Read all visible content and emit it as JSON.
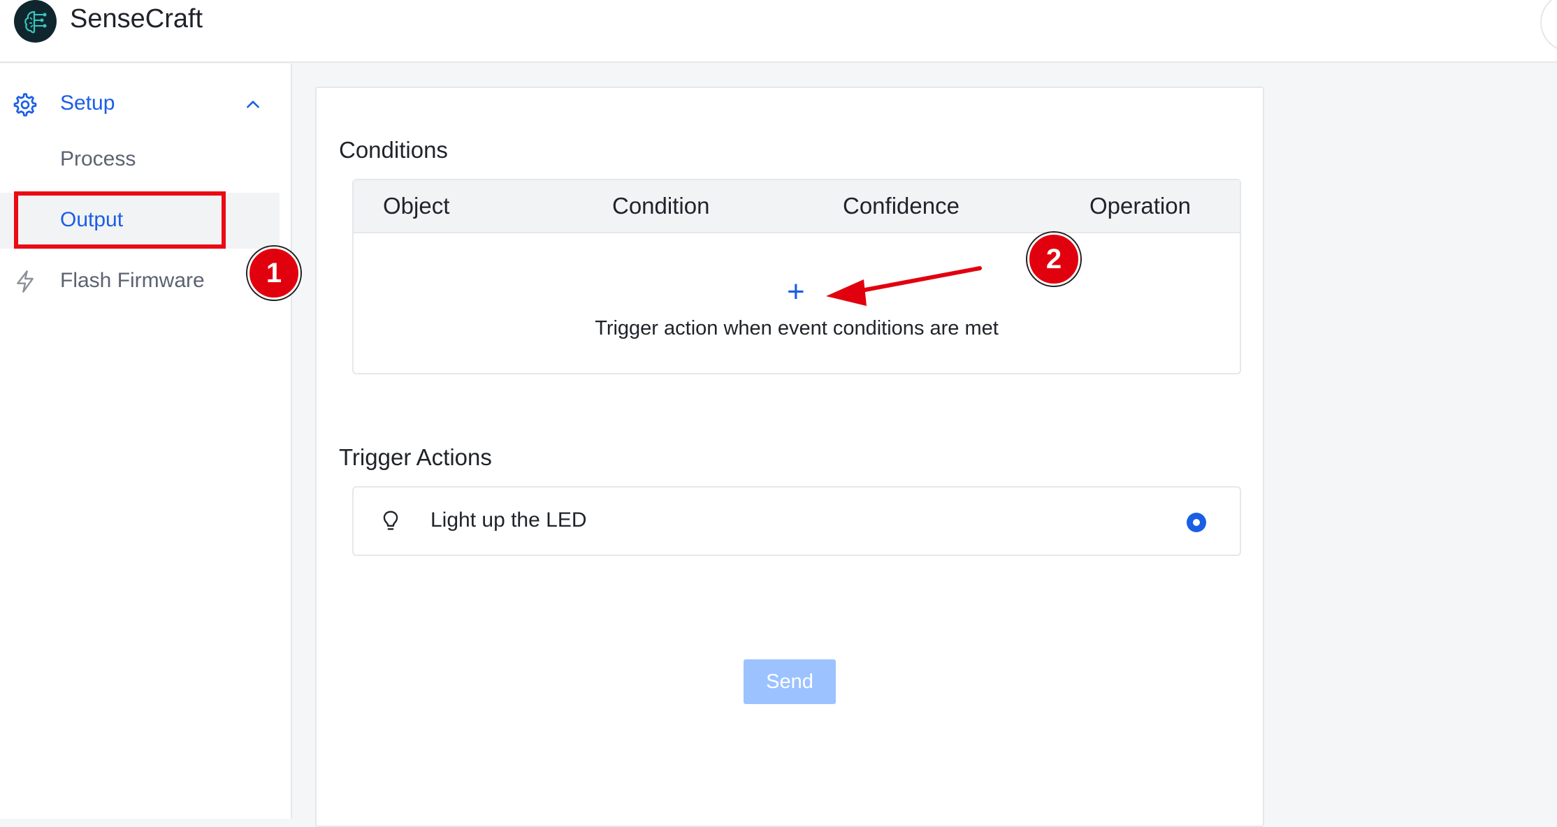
{
  "app": {
    "title": "SenseCraft",
    "logo_icon": "brain-circuit-icon"
  },
  "sidebar": {
    "group": {
      "label": "Setup",
      "icon": "gear-icon",
      "expanded": true
    },
    "items": [
      {
        "label": "Process",
        "active": false
      },
      {
        "label": "Output",
        "active": true
      },
      {
        "label": "Flash Firmware",
        "active": false,
        "icon": "lightning-icon"
      }
    ]
  },
  "annotations": {
    "badge_1": "1",
    "badge_2": "2",
    "highlight_color": "#ea0b14"
  },
  "conditions": {
    "title": "Conditions",
    "columns": [
      "Object",
      "Condition",
      "Confidence",
      "Operation"
    ],
    "add_icon": "+",
    "empty_text": "Trigger action when event conditions are met"
  },
  "trigger_actions": {
    "title": "Trigger Actions",
    "items": [
      {
        "label": "Light up the LED",
        "icon": "lightbulb-icon",
        "selected": true
      }
    ]
  },
  "send_button": {
    "label": "Send",
    "disabled": true
  },
  "colors": {
    "accent": "#1a5ee6",
    "button_disabled": "#9cc2ff",
    "annotation_red": "#e1000e"
  }
}
